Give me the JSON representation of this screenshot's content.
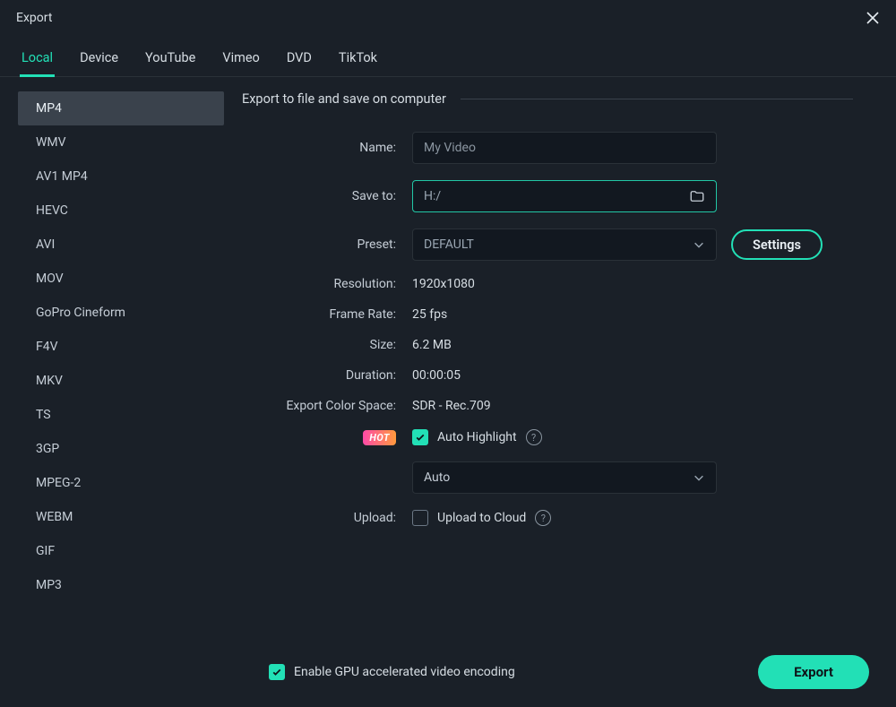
{
  "window": {
    "title": "Export"
  },
  "tabs": [
    {
      "label": "Local",
      "active": true
    },
    {
      "label": "Device"
    },
    {
      "label": "YouTube"
    },
    {
      "label": "Vimeo"
    },
    {
      "label": "DVD"
    },
    {
      "label": "TikTok"
    }
  ],
  "formats": [
    {
      "label": "MP4",
      "active": true
    },
    {
      "label": "WMV"
    },
    {
      "label": "AV1 MP4"
    },
    {
      "label": "HEVC"
    },
    {
      "label": "AVI"
    },
    {
      "label": "MOV"
    },
    {
      "label": "GoPro Cineform"
    },
    {
      "label": "F4V"
    },
    {
      "label": "MKV"
    },
    {
      "label": "TS"
    },
    {
      "label": "3GP"
    },
    {
      "label": "MPEG-2"
    },
    {
      "label": "WEBM"
    },
    {
      "label": "GIF"
    },
    {
      "label": "MP3"
    }
  ],
  "section_header": "Export to file and save on computer",
  "fields": {
    "name_label": "Name:",
    "name_value": "My Video",
    "save_to_label": "Save to:",
    "save_to_value": "H:/",
    "preset_label": "Preset:",
    "preset_value": "DEFAULT",
    "settings_btn": "Settings",
    "resolution_label": "Resolution:",
    "resolution_value": "1920x1080",
    "framerate_label": "Frame Rate:",
    "framerate_value": "25 fps",
    "size_label": "Size:",
    "size_value": "6.2 MB",
    "duration_label": "Duration:",
    "duration_value": "00:00:05",
    "colorspace_label": "Export Color Space:",
    "colorspace_value": "SDR - Rec.709",
    "hot_badge": "HOT",
    "auto_highlight_label": "Auto Highlight",
    "auto_highlight_checked": true,
    "auto_highlight_select_value": "Auto",
    "upload_label": "Upload:",
    "upload_checkbox_label": "Upload to Cloud",
    "upload_checked": false
  },
  "footer": {
    "gpu_label": "Enable GPU accelerated video encoding",
    "gpu_checked": true,
    "export_btn": "Export"
  }
}
